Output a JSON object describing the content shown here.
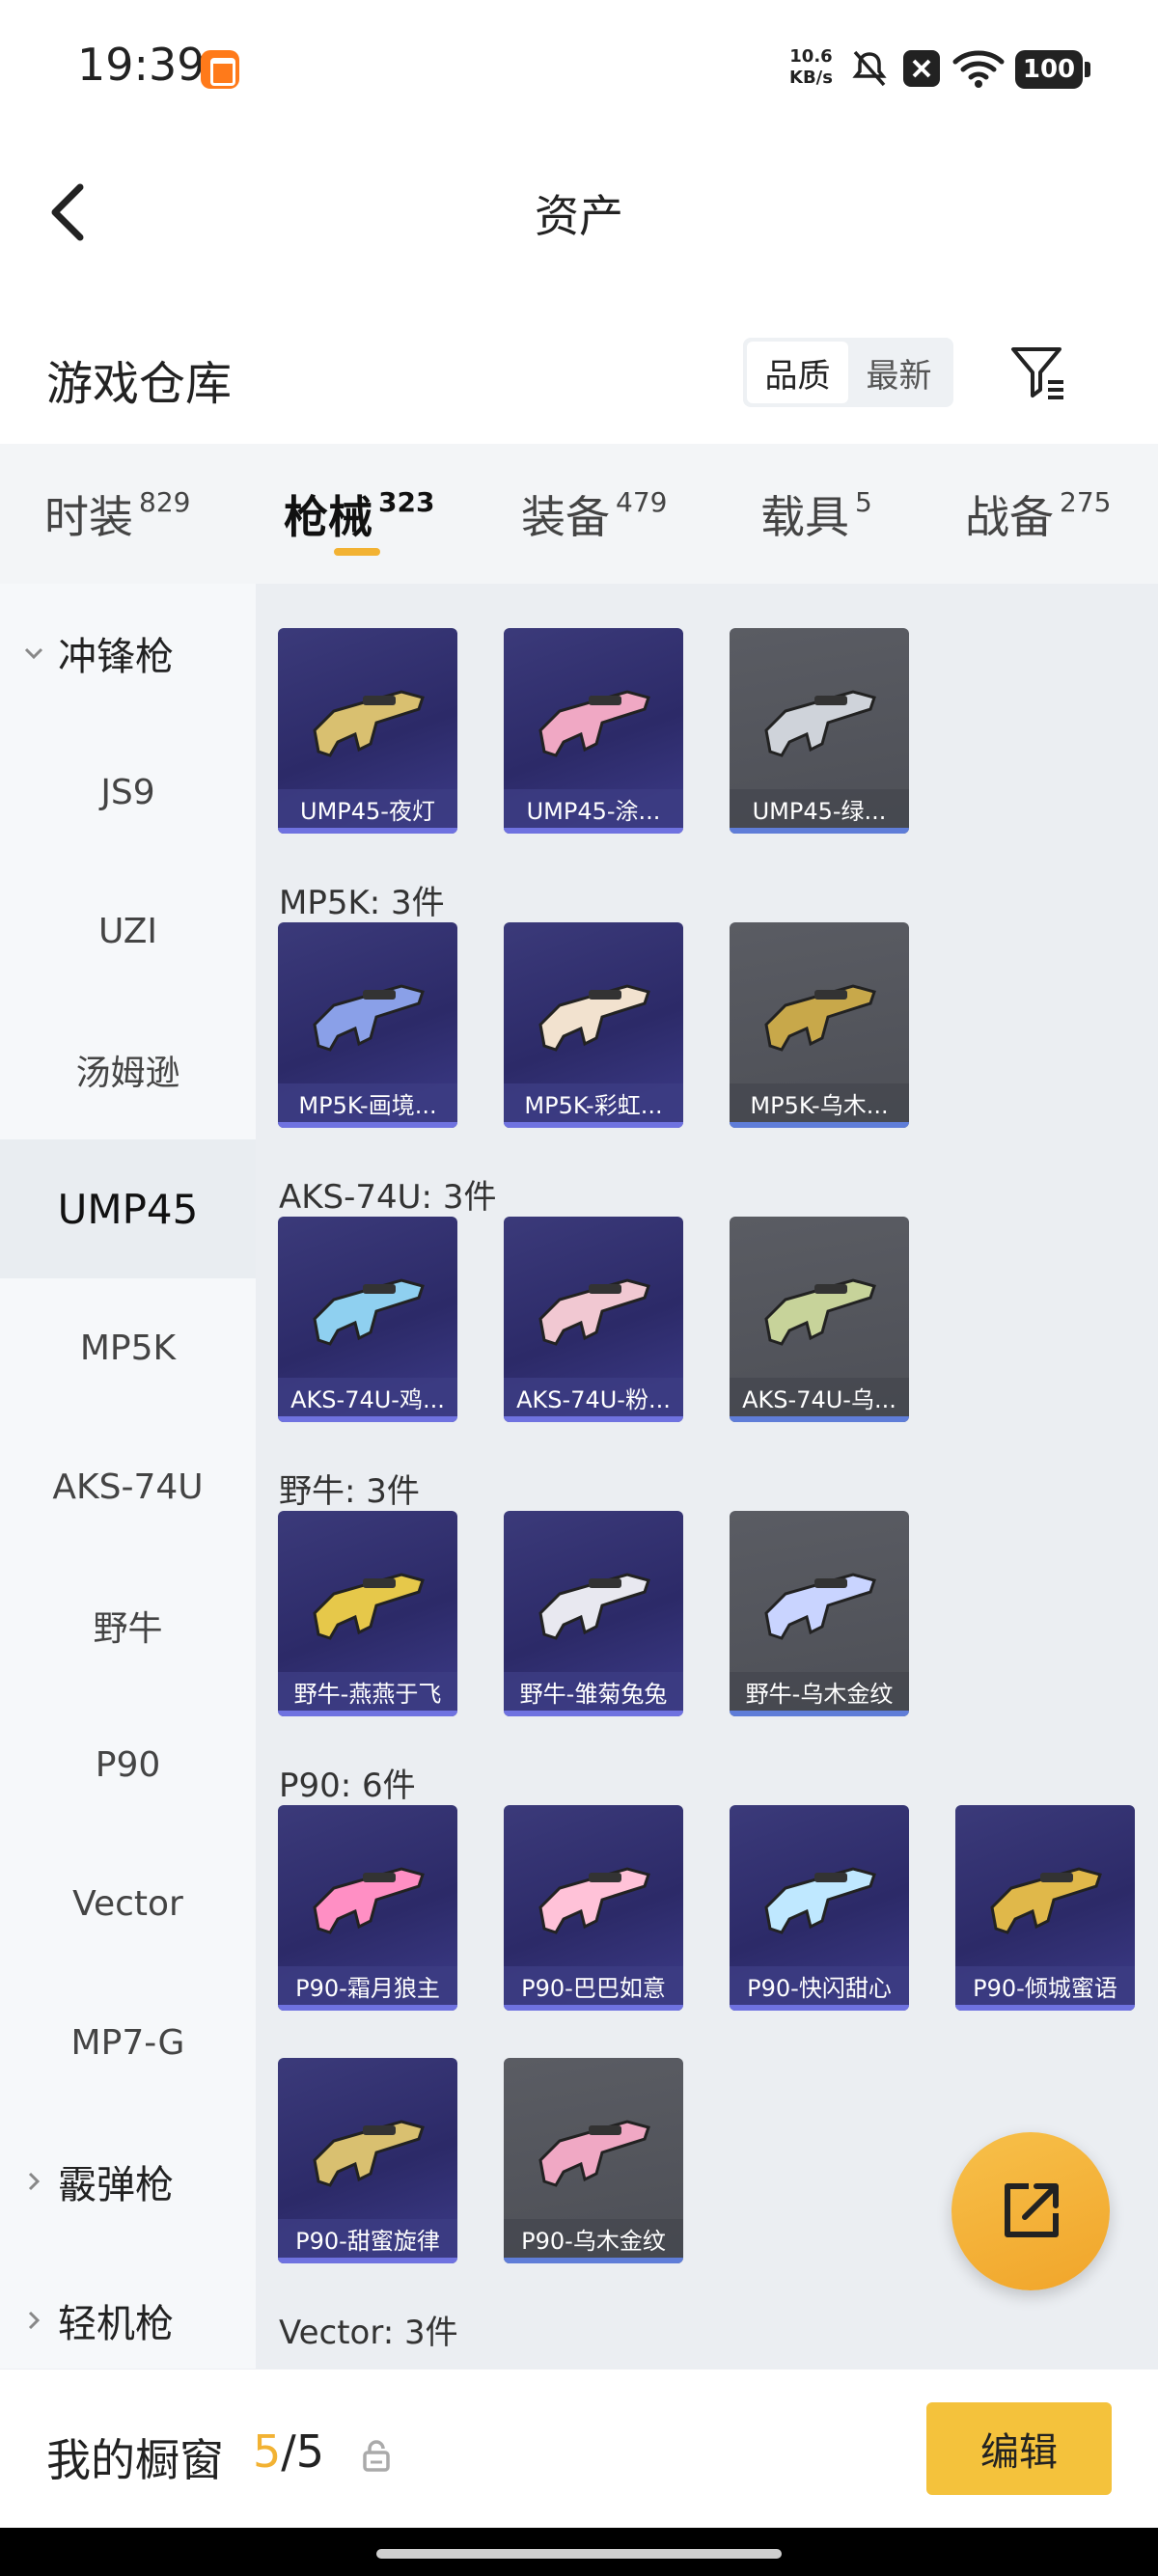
{
  "status_bar": {
    "time": "19:39",
    "speed_value": "10.6",
    "speed_unit": "KB/s",
    "battery": "100",
    "icons": [
      "app-notification-icon",
      "mute-icon",
      "close-box-icon",
      "wifi-icon",
      "battery-icon"
    ]
  },
  "header": {
    "title": "资产",
    "back_icon": "chevron-left-icon"
  },
  "warehouse": {
    "title": "游戏仓库",
    "sort_options": [
      "品质",
      "最新"
    ],
    "active_sort": "品质",
    "filter_icon": "filter-icon"
  },
  "tabs": [
    {
      "label": "时装",
      "count": "829"
    },
    {
      "label": "枪械",
      "count": "323",
      "active": true
    },
    {
      "label": "装备",
      "count": "479"
    },
    {
      "label": "载具",
      "count": "5"
    },
    {
      "label": "战备",
      "count": "275"
    }
  ],
  "sidebar": {
    "group_open": "冲锋枪",
    "items": [
      "JS9",
      "UZI",
      "汤姆逊",
      "UMP45",
      "MP5K",
      "AKS-74U",
      "野牛",
      "P90",
      "Vector",
      "MP7-G"
    ],
    "active_item": "UMP45",
    "groups_closed": [
      "霰弹枪",
      "轻机枪"
    ]
  },
  "sections": [
    {
      "title": "",
      "items": [
        {
          "name": "UMP45-夜灯",
          "style": "purple"
        },
        {
          "name": "UMP45-涂...",
          "style": "purple"
        },
        {
          "name": "UMP45-绿...",
          "style": "grey"
        }
      ]
    },
    {
      "title": "MP5K: 3件",
      "items": [
        {
          "name": "MP5K-画境...",
          "style": "purple"
        },
        {
          "name": "MP5K-彩虹...",
          "style": "purple"
        },
        {
          "name": "MP5K-乌木...",
          "style": "grey"
        }
      ]
    },
    {
      "title": "AKS-74U: 3件",
      "items": [
        {
          "name": "AKS-74U-鸡...",
          "style": "purple"
        },
        {
          "name": "AKS-74U-粉...",
          "style": "purple"
        },
        {
          "name": "AKS-74U-乌...",
          "style": "grey"
        }
      ]
    },
    {
      "title": "野牛: 3件",
      "items": [
        {
          "name": "野牛-燕燕于飞",
          "style": "purple"
        },
        {
          "name": "野牛-雏菊兔兔",
          "style": "purple"
        },
        {
          "name": "野牛-乌木金纹",
          "style": "grey"
        }
      ]
    },
    {
      "title": "P90: 6件",
      "items": [
        {
          "name": "P90-霜月狼主",
          "style": "purple"
        },
        {
          "name": "P90-巴巴如意",
          "style": "purple"
        },
        {
          "name": "P90-快闪甜心",
          "style": "purple"
        },
        {
          "name": "P90-倾城蜜语",
          "style": "purple"
        },
        {
          "name": "P90-甜蜜旋律",
          "style": "purple"
        },
        {
          "name": "P90-乌木金纹",
          "style": "grey"
        }
      ]
    },
    {
      "title": "Vector: 3件",
      "items": []
    }
  ],
  "colors": {
    "accent": "#f2b233",
    "card_purple": "#2c2a68",
    "card_grey": "#4d4f56"
  },
  "fab": {
    "icon": "share-external-icon"
  },
  "bottom": {
    "showcase_label": "我的橱窗",
    "current": "5",
    "sep_total": "/5",
    "lock_icon": "lock-icon",
    "edit_label": "编辑"
  }
}
